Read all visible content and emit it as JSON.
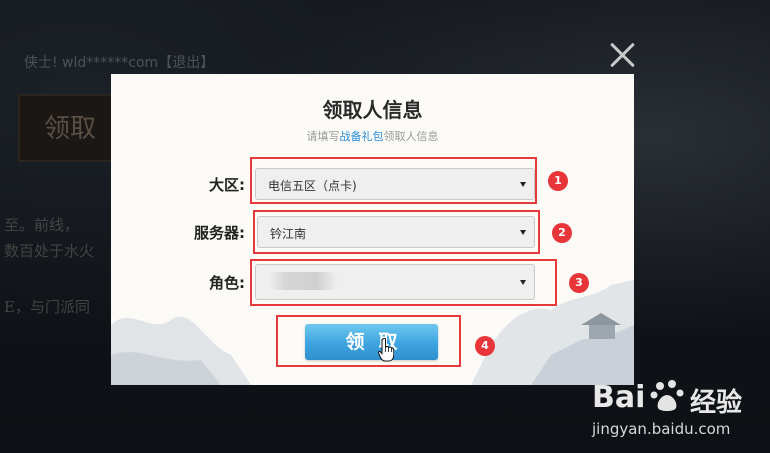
{
  "background": {
    "user_line": "侠士! wld******com【退出】",
    "tab_text": "领取",
    "story_line_1": "至。前线，",
    "story_line_2": "数百处于水火",
    "story_line_3": "E，与门派同"
  },
  "dialog": {
    "title": "领取人信息",
    "subtitle_prefix": "请填写",
    "subtitle_highlight": "战备礼包",
    "subtitle_suffix": "领取人信息",
    "fields": [
      {
        "label": "大区:",
        "value": "电信五区（点卡)"
      },
      {
        "label": "服务器:",
        "value": "钤江南"
      },
      {
        "label": "角色:",
        "value": ""
      }
    ],
    "claim_button": "领取"
  },
  "annotations": [
    "1",
    "2",
    "3",
    "4"
  ],
  "watermark": {
    "brand_left": "Bai",
    "brand_right": "经验",
    "url": "jingyan.baidu.com"
  },
  "colors": {
    "annotation_red": "#e5393c",
    "button_blue": "#3ea4df",
    "link_blue": "#2b8ed6"
  }
}
